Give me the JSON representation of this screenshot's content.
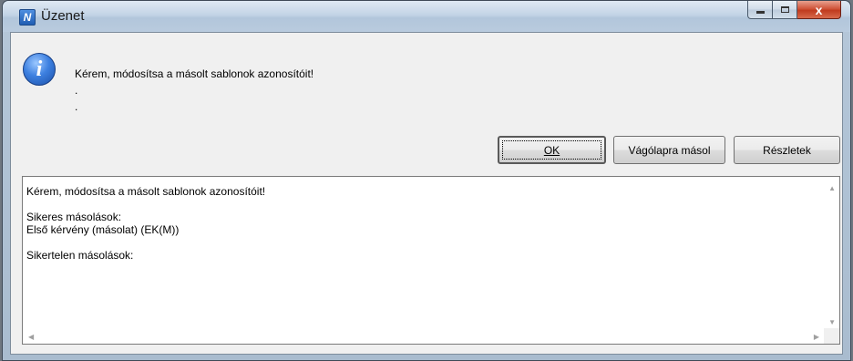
{
  "window": {
    "title": "Üzenet",
    "app_icon_glyph": "N"
  },
  "caption": {
    "minimize": "minimize",
    "maximize": "maximize",
    "close": "x"
  },
  "message": {
    "icon": "info-icon",
    "icon_glyph": "i",
    "line1": "Kérem, módosítsa a másolt sablonok azonosítóit!",
    "line2": ".",
    "line3": "."
  },
  "buttons": {
    "ok": "OK",
    "copy": "Vágólapra másol",
    "details": "Részletek"
  },
  "details_text": "Kérem, módosítsa a másolt sablonok azonosítóit!\n\nSikeres másolások:\nElső kérvény (másolat) (EK(M))\n\nSikertelen másolások:",
  "colors": {
    "close_button": "#c03a1e",
    "title_bar": "#c3d4e6",
    "info_icon": "#3d80e0"
  }
}
